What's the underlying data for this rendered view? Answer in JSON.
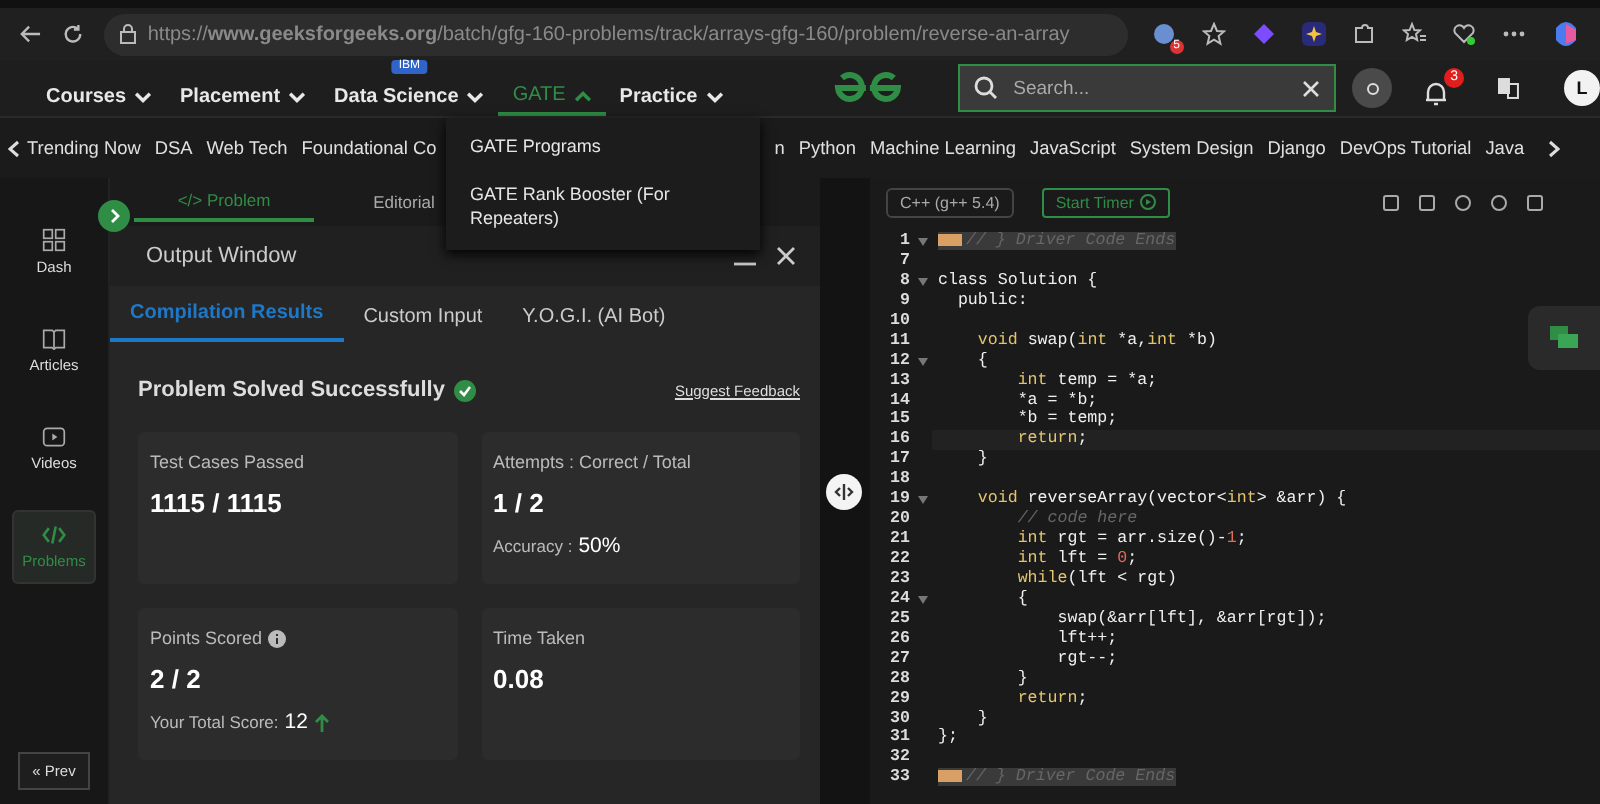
{
  "browser": {
    "url": "https://**www.geeksforgeeks.org**/batch/gfg-160-problems/track/arrays-gfg-160/problem/reverse-an-array",
    "extension_badge": "5"
  },
  "nav": {
    "items": [
      {
        "label": "Courses",
        "selected": false
      },
      {
        "label": "Placement",
        "selected": false
      },
      {
        "label": "Data Science",
        "selected": false,
        "badge": "IBM"
      },
      {
        "label": "GATE",
        "selected": true
      },
      {
        "label": "Practice",
        "selected": false
      }
    ],
    "search": {
      "placeholder": "Search..."
    },
    "notification_count": "3",
    "avatar": "L"
  },
  "subnav": [
    "Trending Now",
    "DSA",
    "Web Tech",
    "Foundational Co",
    "n",
    "Python",
    "Machine Learning",
    "JavaScript",
    "System Design",
    "Django",
    "DevOps Tutorial",
    "Java"
  ],
  "dropdown": [
    "GATE Programs",
    "GATE Rank Booster (For Repeaters)"
  ],
  "sidebar": {
    "items": [
      {
        "label": "Dash",
        "selected": false
      },
      {
        "label": "Articles",
        "selected": false
      },
      {
        "label": "Videos",
        "selected": false
      },
      {
        "label": "Problems",
        "selected": true
      }
    ],
    "prev": "« Prev"
  },
  "problem_tabs": [
    {
      "label": "</> Problem",
      "selected": true
    },
    {
      "label": "Editorial",
      "selected": false
    }
  ],
  "output": {
    "title": "Output Window",
    "tabs": [
      {
        "label": "Compilation Results",
        "selected": true
      },
      {
        "label": "Custom Input",
        "selected": false
      },
      {
        "label": "Y.O.G.I. (AI Bot)",
        "selected": false
      }
    ],
    "status": "Problem Solved Successfully",
    "feedback": "Suggest Feedback",
    "cards": [
      {
        "label": "Test Cases Passed",
        "value": "1115 / 1115"
      },
      {
        "label": "Attempts : Correct / Total",
        "value": "1 / 2",
        "note": "Accuracy :",
        "note_value": "50%"
      },
      {
        "label": "Points Scored",
        "value": "2 / 2",
        "info": true,
        "note": "Your Total Score:",
        "note_value": "12",
        "trend_up": true
      },
      {
        "label": "Time Taken",
        "value": "0.08"
      }
    ]
  },
  "editor": {
    "language": "C++ (g++ 5.4)",
    "timer": "Start Timer",
    "lines": [
      {
        "n": "1",
        "fold": true,
        "folded": true,
        "highlight": true,
        "segs": [
          {
            "kind": "comment",
            "t": "// } Driver Code Ends"
          }
        ]
      },
      {
        "n": "7"
      },
      {
        "n": "8",
        "fold": true,
        "segs": [
          {
            "kind": "plain",
            "t": "class Solution {"
          }
        ]
      },
      {
        "n": "9",
        "segs": [
          {
            "kind": "plain",
            "t": "  public:"
          }
        ]
      },
      {
        "n": "10"
      },
      {
        "n": "11",
        "segs": [
          {
            "kind": "keyword",
            "t": "    void "
          },
          {
            "kind": "plain",
            "t": "swap("
          },
          {
            "kind": "keyword",
            "t": "int "
          },
          {
            "kind": "plain",
            "t": "*a,"
          },
          {
            "kind": "keyword",
            "t": "int "
          },
          {
            "kind": "plain",
            "t": "*b)"
          }
        ]
      },
      {
        "n": "12",
        "fold": true,
        "segs": [
          {
            "kind": "plain",
            "t": "    {"
          }
        ]
      },
      {
        "n": "13",
        "segs": [
          {
            "kind": "keyword",
            "t": "        int "
          },
          {
            "kind": "plain",
            "t": "temp = *a;"
          }
        ]
      },
      {
        "n": "14",
        "segs": [
          {
            "kind": "plain",
            "t": "        *a = *b;"
          }
        ]
      },
      {
        "n": "15",
        "segs": [
          {
            "kind": "plain",
            "t": "        *b = temp;"
          }
        ]
      },
      {
        "n": "16",
        "current": true,
        "segs": [
          {
            "kind": "keyword",
            "t": "        return"
          },
          {
            "kind": "plain",
            "t": ";"
          }
        ]
      },
      {
        "n": "17",
        "segs": [
          {
            "kind": "plain",
            "t": "    }"
          }
        ]
      },
      {
        "n": "18"
      },
      {
        "n": "19",
        "fold": true,
        "segs": [
          {
            "kind": "keyword",
            "t": "    void "
          },
          {
            "kind": "plain",
            "t": "reverseArray(vector<"
          },
          {
            "kind": "keyword",
            "t": "int"
          },
          {
            "kind": "plain",
            "t": "> &arr) {"
          }
        ]
      },
      {
        "n": "20",
        "segs": [
          {
            "kind": "comment",
            "t": "        // code here"
          }
        ]
      },
      {
        "n": "21",
        "segs": [
          {
            "kind": "keyword",
            "t": "        int "
          },
          {
            "kind": "plain",
            "t": "rgt = arr.size()-"
          },
          {
            "kind": "number",
            "t": "1"
          },
          {
            "kind": "plain",
            "t": ";"
          }
        ]
      },
      {
        "n": "22",
        "segs": [
          {
            "kind": "keyword",
            "t": "        int "
          },
          {
            "kind": "plain",
            "t": "lft = "
          },
          {
            "kind": "number",
            "t": "0"
          },
          {
            "kind": "plain",
            "t": ";"
          }
        ]
      },
      {
        "n": "23",
        "segs": [
          {
            "kind": "keyword",
            "t": "        while"
          },
          {
            "kind": "plain",
            "t": "(lft < rgt)"
          }
        ]
      },
      {
        "n": "24",
        "fold": true,
        "segs": [
          {
            "kind": "plain",
            "t": "        {"
          }
        ]
      },
      {
        "n": "25",
        "segs": [
          {
            "kind": "plain",
            "t": "            swap(&arr[lft], &arr[rgt]);"
          }
        ]
      },
      {
        "n": "26",
        "segs": [
          {
            "kind": "plain",
            "t": "            lft++;"
          }
        ]
      },
      {
        "n": "27",
        "segs": [
          {
            "kind": "plain",
            "t": "            rgt--;"
          }
        ]
      },
      {
        "n": "28",
        "segs": [
          {
            "kind": "plain",
            "t": "        }"
          }
        ]
      },
      {
        "n": "29",
        "segs": [
          {
            "kind": "keyword",
            "t": "        return"
          },
          {
            "kind": "plain",
            "t": ";"
          }
        ]
      },
      {
        "n": "30",
        "segs": [
          {
            "kind": "plain",
            "t": "    }"
          }
        ]
      },
      {
        "n": "31",
        "segs": [
          {
            "kind": "plain",
            "t": "};"
          }
        ]
      },
      {
        "n": "32"
      },
      {
        "n": "33",
        "folded": true,
        "highlight": true,
        "segs": [
          {
            "kind": "comment",
            "t": "// } Driver Code Ends"
          }
        ]
      }
    ]
  }
}
